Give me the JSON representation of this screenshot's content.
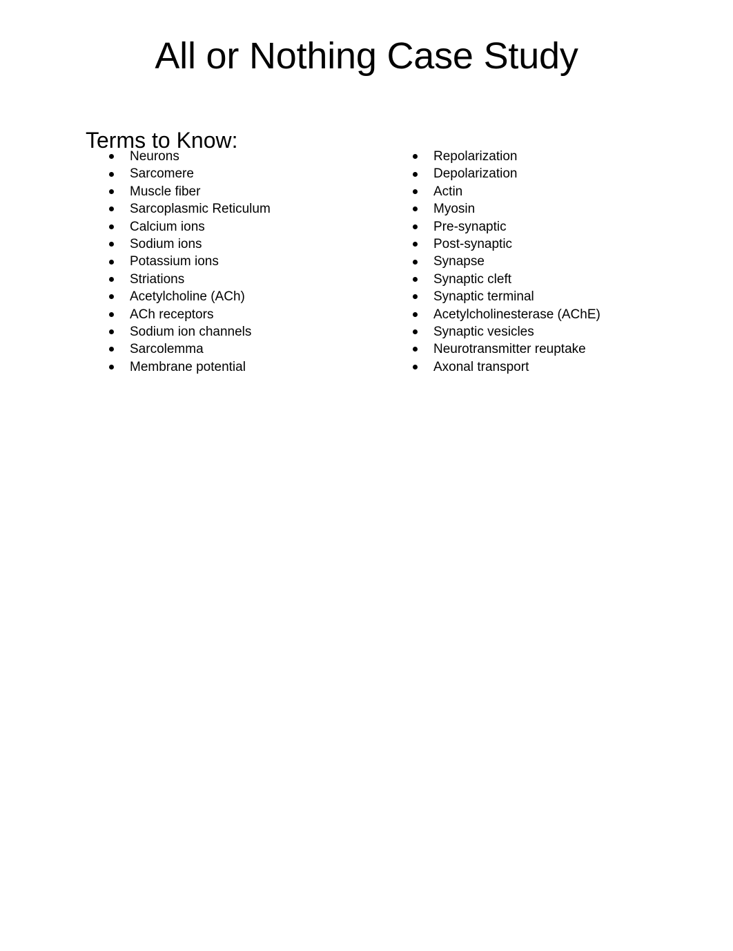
{
  "document": {
    "title": "All or Nothing Case Study",
    "background_color": "#ffffff",
    "text_color": "#000000"
  },
  "section": {
    "heading": "Terms to Know:",
    "bullet_glyph": "•"
  },
  "terms": {
    "left_column": [
      "Neurons",
      "Sarcomere",
      "Muscle fiber",
      "Sarcoplasmic Reticulum",
      "Calcium ions",
      "Sodium ions",
      "Potassium ions",
      "Striations",
      "Acetylcholine (ACh)",
      "ACh receptors",
      "Sodium ion channels",
      "Sarcolemma",
      "Membrane potential"
    ],
    "right_column": [
      "Repolarization",
      "Depolarization",
      "Actin",
      "Myosin",
      "Pre-synaptic",
      "Post-synaptic",
      "Synapse",
      "Synaptic cleft",
      "Synaptic terminal",
      "Acetylcholinesterase (AChE)",
      "Synaptic vesicles",
      "Neurotransmitter reuptake",
      "Axonal transport"
    ]
  }
}
